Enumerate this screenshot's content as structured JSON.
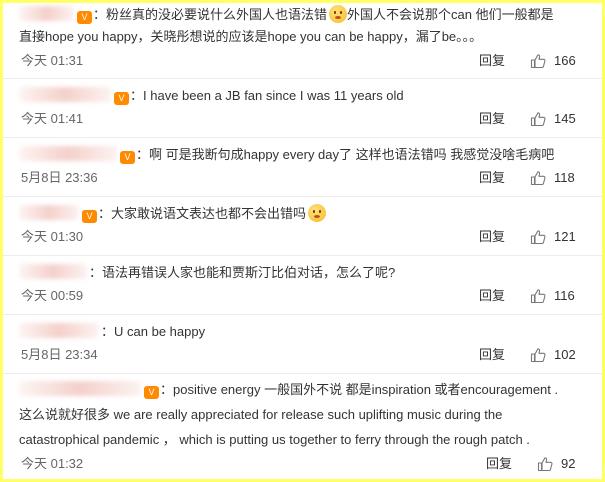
{
  "comments": [
    {
      "text": "粉丝真的没必要说什么外国人也语法错",
      "text2": "外国人不会说那个can 他们一般都是",
      "text3": "直接hope you happy，关晓彤想说的应该是hope you can be happy，漏了be。。。",
      "time": "今天 01:31",
      "reply": "回复",
      "likes": "166"
    },
    {
      "text": "I have been a JB fan since I was 11 years old",
      "time": "今天 01:41",
      "reply": "回复",
      "likes": "145"
    },
    {
      "text": "啊 可是我断句成happy every day了 这样也语法错吗 我感觉没啥毛病吧",
      "time": "5月8日 23:36",
      "reply": "回复",
      "likes": "118"
    },
    {
      "text": "大家敢说语文表达也都不会出错吗",
      "time": "今天 01:30",
      "reply": "回复",
      "likes": "121"
    },
    {
      "text": "语法再错误人家也能和贾斯汀比伯对话，怎么了呢?",
      "time": "今天 00:59",
      "reply": "回复",
      "likes": "116"
    },
    {
      "text": "U can be happy",
      "time": "5月8日 23:34",
      "reply": "回复",
      "likes": "102"
    },
    {
      "text": "positive energy 一般国外不说 都是inspiration 或者encouragement .",
      "text2": "这么说就好很多 we are really appreciated for release such uplifting music during the",
      "text3": "catastrophical pandemic ， which is putting us together to ferry through the rough patch .",
      "time": "今天 01:32",
      "reply": "回复",
      "likes": "92"
    }
  ],
  "icons": {
    "like": "thumb-up-icon",
    "verified": "v-badge-icon",
    "emoji": "emoji-icon"
  },
  "colors": {
    "frame": "#ffff66",
    "badge": "#ff8a00",
    "text": "#333333",
    "meta": "#666666"
  }
}
